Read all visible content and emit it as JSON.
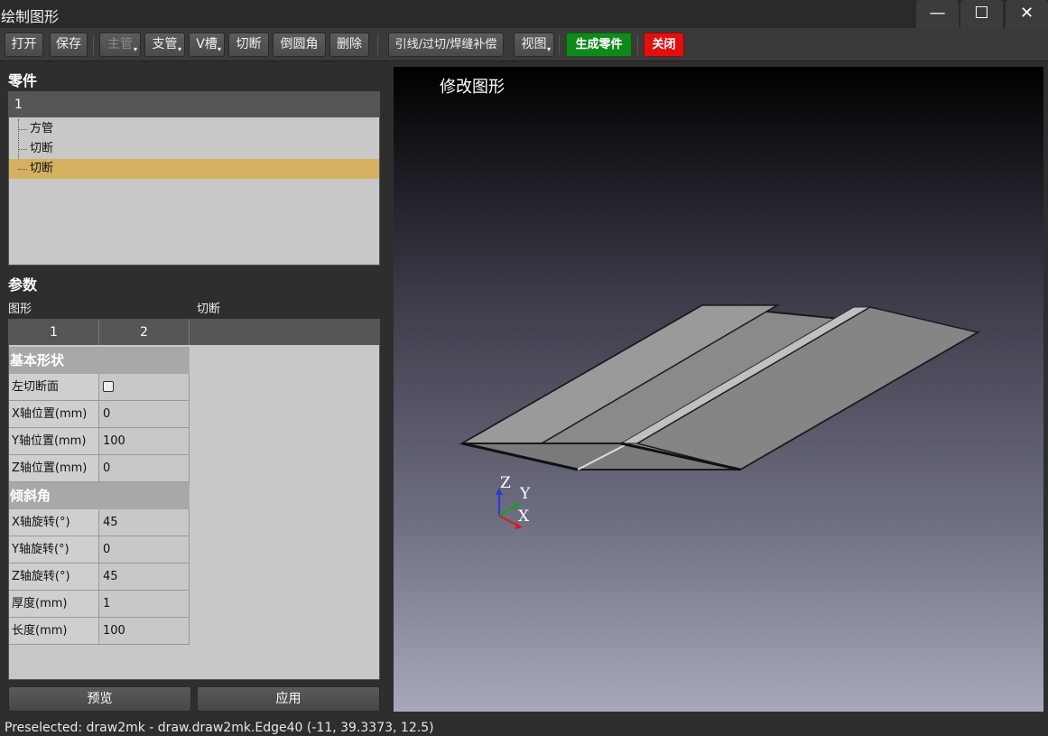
{
  "window": {
    "title": "绘制图形",
    "minimize": "—",
    "maximize": "☐",
    "close": "✕"
  },
  "toolbar": {
    "open": "打开",
    "save": "保存",
    "main_pipe": "主管",
    "branch_pipe": "支管",
    "v_groove": "V槽",
    "cut": "切断",
    "fillet": "倒圆角",
    "delete": "删除",
    "lead_weld": "引线/过切/焊缝补偿",
    "view": "视图",
    "generate": "生成零件",
    "close": "关闭",
    "dropdown_glyph": "▾"
  },
  "parts": {
    "section_title": "零件",
    "tree_header": "1",
    "items": [
      "方管",
      "切断",
      "切断"
    ],
    "selected_index": 2
  },
  "params": {
    "section_title": "参数",
    "shape_label": "图形",
    "shape_value": "切断",
    "tabs": [
      "1",
      "2"
    ],
    "groups": [
      {
        "title": "基本形状",
        "rows": [
          {
            "key": "左切断面",
            "value": "",
            "type": "checkbox",
            "checked": false
          },
          {
            "key": "X轴位置(mm)",
            "value": "0"
          },
          {
            "key": "Y轴位置(mm)",
            "value": "100"
          },
          {
            "key": "Z轴位置(mm)",
            "value": "0"
          }
        ]
      },
      {
        "title": "倾斜角",
        "rows": [
          {
            "key": "X轴旋转(°)",
            "value": "45"
          },
          {
            "key": "Y轴旋转(°)",
            "value": "0"
          },
          {
            "key": "Z轴旋转(°)",
            "value": "45"
          },
          {
            "key": "厚度(mm)",
            "value": "1"
          },
          {
            "key": "长度(mm)",
            "value": "100"
          }
        ]
      }
    ],
    "preview_button": "预览",
    "apply_button": "应用"
  },
  "viewport": {
    "title": "修改图形",
    "axes": {
      "z": "Z",
      "y": "Y",
      "x": "X"
    },
    "colors": {
      "z": "#2a3ad0",
      "y": "#18a018",
      "x": "#d02020"
    }
  },
  "status": {
    "text": "Preselected: draw2mk - draw.draw2mk.Edge40 (-11, 39.3373, 12.5)"
  }
}
